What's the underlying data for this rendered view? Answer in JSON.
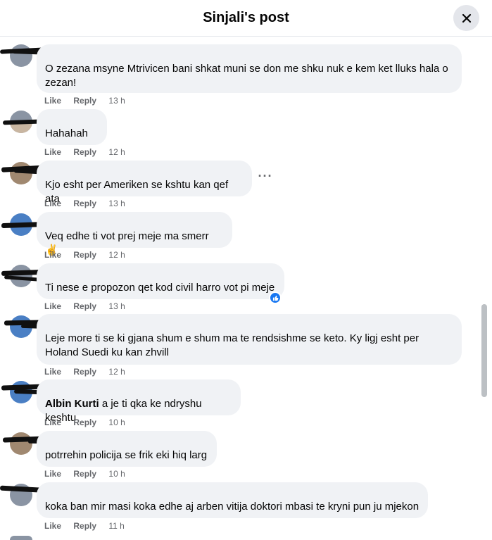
{
  "header": {
    "title": "Sinjali's post"
  },
  "icons": {
    "close": "close-icon",
    "more": "more-options-icon",
    "like_reaction": "thumbs-up-icon"
  },
  "actions": {
    "like": "Like",
    "reply": "Reply"
  },
  "comments": [
    {
      "author": "",
      "text": "O zezana msyne Mtrivicen bani shkat muni se don me shku nuk e kem ket lluks hala o zezan!",
      "time": "13 h"
    },
    {
      "author": "",
      "text": "Hahahah",
      "time": "12 h"
    },
    {
      "author": "",
      "text": "Kjo esht per Ameriken se kshtu kan qef ata",
      "time": "13 h"
    },
    {
      "author": "",
      "text": "Veq edhe ti vot prej meje ma smerr ✌️",
      "time": "12 h"
    },
    {
      "author": "",
      "text": "Ti nese e propozon qet kod civil harro vot pi meje",
      "time": "13 h"
    },
    {
      "author": "",
      "text": "Leje more ti se ki gjana shum e shum ma te rendsishme se keto. Ky ligj esht per Holand Suedi ku kan zhvill",
      "time": "12 h"
    },
    {
      "author": "",
      "mention": "Albin Kurti",
      "text": " a je ti qka ke ndryshu keshtu",
      "time": "10 h"
    },
    {
      "author": "",
      "text": "potrrehin policija se frik eki hiq larg",
      "time": "10 h"
    },
    {
      "author": "",
      "text": "koka ban mir masi koka edhe aj arben vitija doktori mbasi te kryni pun ju mjekon",
      "time": "11 h"
    }
  ],
  "colors": {
    "bubble": "#f0f2f5",
    "meta": "#65676b",
    "accent": "#1877f2"
  }
}
